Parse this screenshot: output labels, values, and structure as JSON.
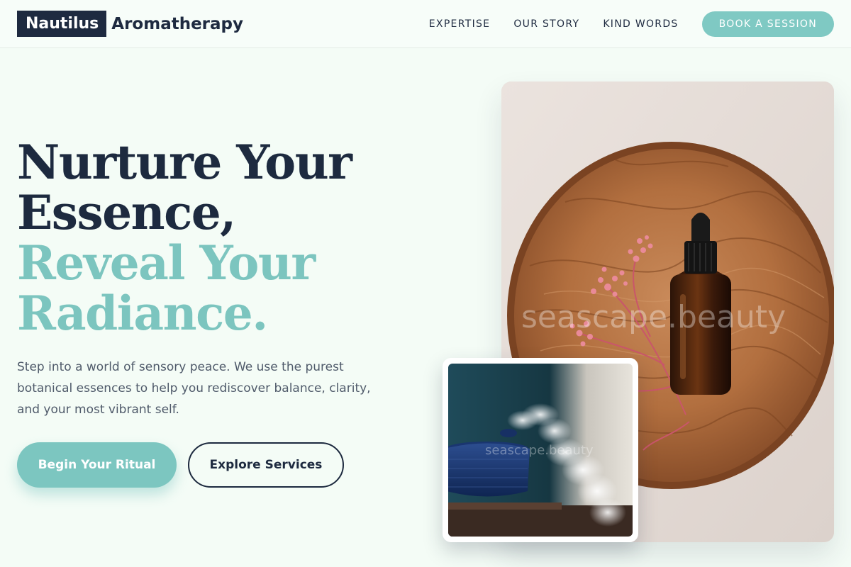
{
  "brand": {
    "mark": "Nautilus",
    "name": "Aromatherapy"
  },
  "nav": {
    "items": [
      "EXPERTISE",
      "OUR STORY",
      "KIND WORDS"
    ],
    "cta": "BOOK A SESSION"
  },
  "hero": {
    "title_line1": "Nurture Your",
    "title_line2": "Essence,",
    "title_line3": "Reveal Your",
    "title_line4": "Radiance.",
    "description": "Step into a world of sensory peace. We use the purest botanical essences to help you rediscover balance, clarity, and your most vibrant self.",
    "primary_button": "Begin Your Ritual",
    "secondary_button": "Explore Services"
  },
  "images": {
    "main_watermark": "seascape.beauty",
    "inset_watermark": "seascape.beauty"
  },
  "colors": {
    "navy": "#1d2a3f",
    "teal": "#7cc5bf",
    "background": "#f4fcf6"
  }
}
